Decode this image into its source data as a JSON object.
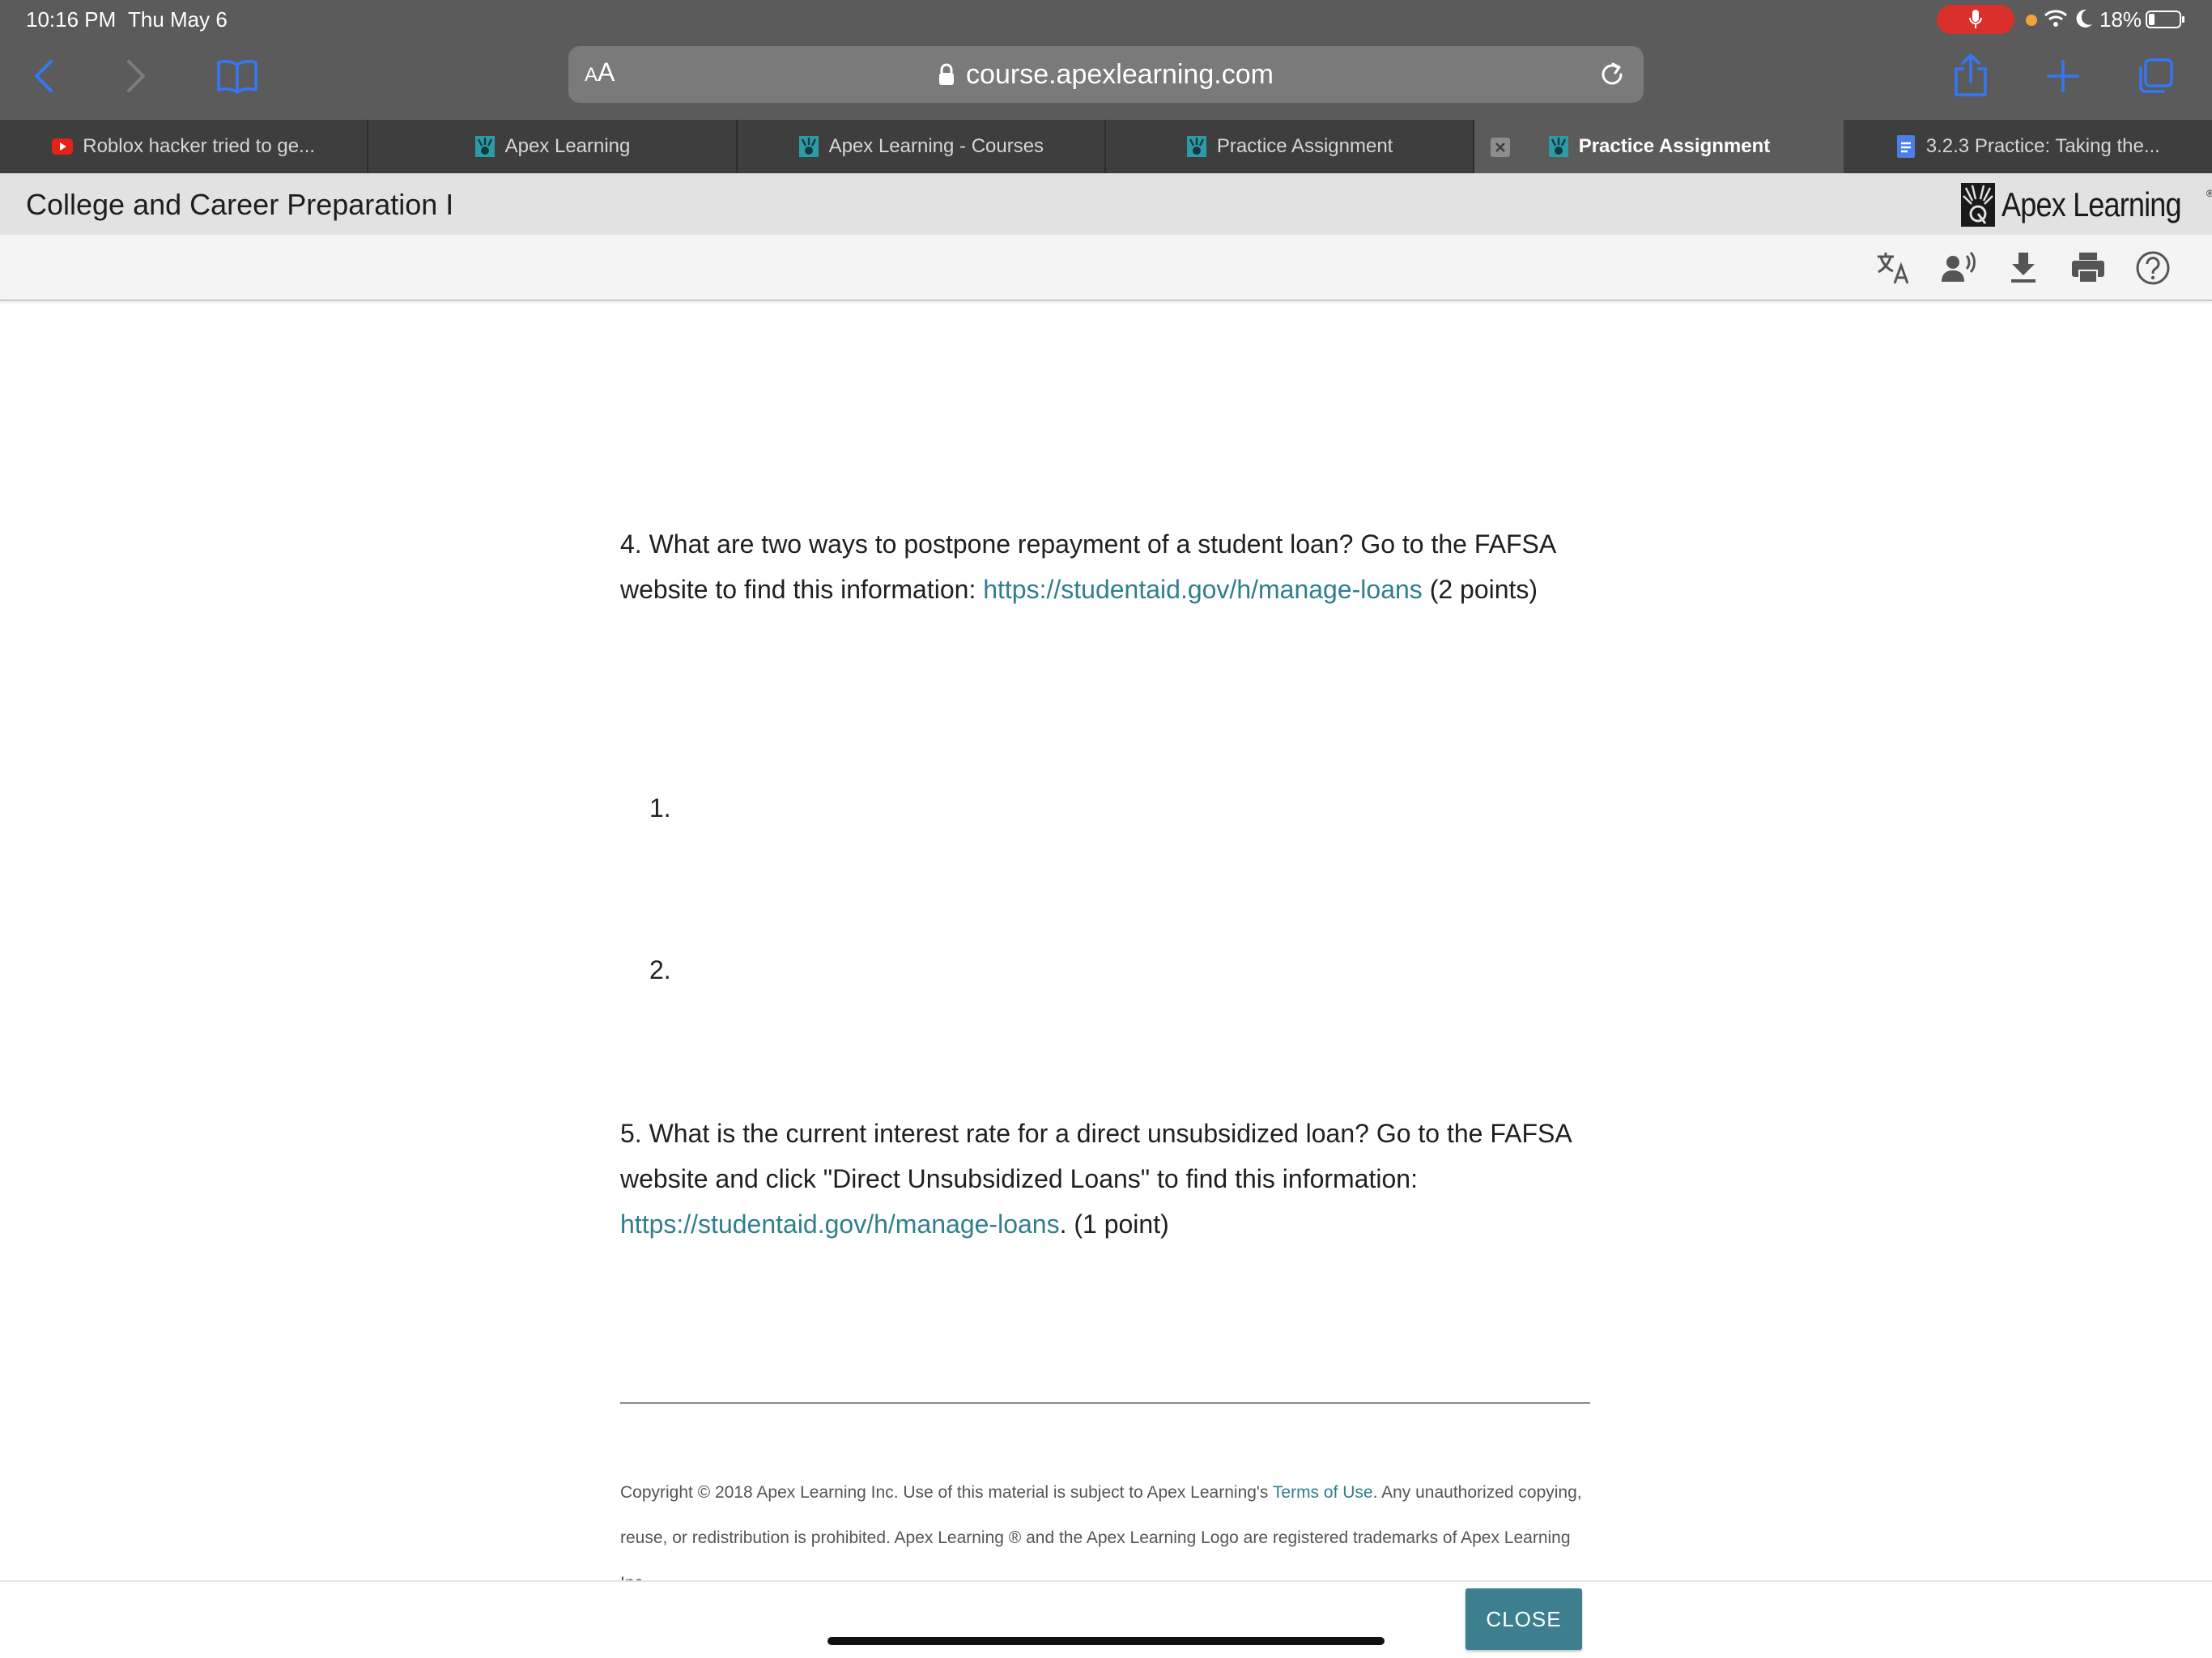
{
  "status_bar": {
    "time": "10:16 PM",
    "date": "Thu May 6",
    "battery": "18%"
  },
  "browser": {
    "reader_label_small": "A",
    "reader_label_large": "A",
    "url": "course.apexlearning.com",
    "icons": {
      "back": "chevron-left-icon",
      "forward": "chevron-right-icon",
      "bookmarks": "book-icon",
      "reload": "reload-icon",
      "share": "share-icon",
      "new_tab": "plus-icon",
      "tabs": "tabs-overview-icon"
    },
    "accent_color": "#3478f6",
    "tabs": [
      {
        "label": "Roblox hacker tried to ge...",
        "icon": "youtube-icon",
        "active": false
      },
      {
        "label": "Apex Learning",
        "icon": "apex-favicon-icon",
        "active": false
      },
      {
        "label": "Apex Learning - Courses",
        "icon": "apex-favicon-icon",
        "active": false
      },
      {
        "label": "Practice Assignment",
        "icon": "apex-favicon-icon",
        "active": false
      },
      {
        "label": "Practice Assignment",
        "icon": "apex-favicon-icon",
        "active": true
      },
      {
        "label": "3.2.3 Practice: Taking the...",
        "icon": "google-docs-icon",
        "active": false
      }
    ]
  },
  "header": {
    "course_title": "College and Career Preparation I",
    "logo_text": "Apex Learning",
    "logo_mark": "®"
  },
  "tools": [
    "translate-icon",
    "read-aloud-icon",
    "download-icon",
    "print-icon",
    "help-icon"
  ],
  "content": {
    "q4": {
      "text_before": "4. What are two ways to postpone repayment of a student loan? Go to the FAFSA website to find this information: ",
      "link": "https://studentaid.gov/h/manage-loans",
      "text_after": " (2 points)",
      "answers": [
        "1.",
        "2."
      ]
    },
    "q5": {
      "text_before": "5. What is the current interest rate for a direct unsubsidized loan? Go to the FAFSA website and click \"Direct Unsubsidized Loans\" to find this information: ",
      "link": "https://studentaid.gov/h/manage-loans",
      "text_after": ". (1 point)"
    },
    "link_color": "#2f7f8c"
  },
  "footer": {
    "text_before": "Copyright © 2018 Apex Learning Inc. Use of this material is subject to Apex Learning's ",
    "link": "Terms of Use",
    "text_after": ". Any unauthorized copying, reuse, or redistribution is prohibited. Apex Learning ® and the Apex Learning Logo are registered trademarks of Apex Learning Inc."
  },
  "bottom_bar": {
    "close_label": "CLOSE",
    "button_color": "#3d7f8f"
  }
}
